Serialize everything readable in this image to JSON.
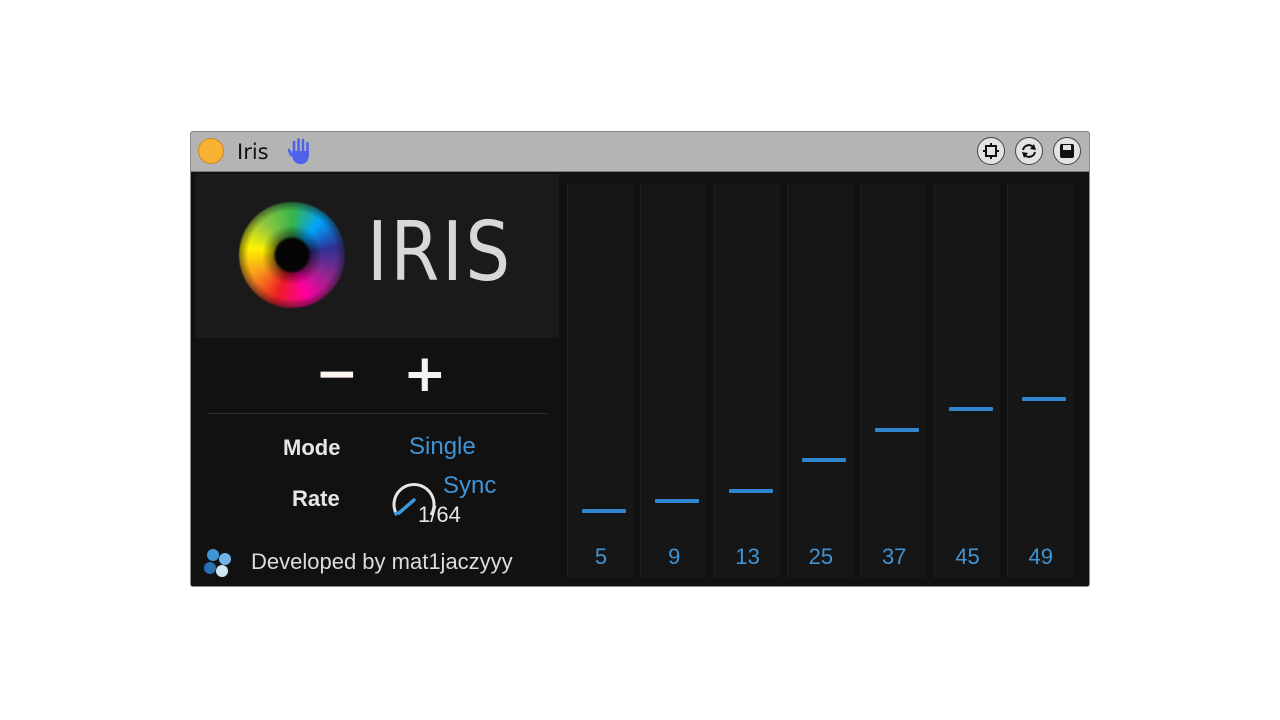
{
  "titlebar": {
    "title": "Iris"
  },
  "logo": {
    "wordmark": "IRIS"
  },
  "controls": {
    "minus_label": "−",
    "plus_label": "+",
    "mode_label": "Mode",
    "mode_value": "Single",
    "rate_label": "Rate",
    "rate_sync": "Sync",
    "rate_value": "1/64"
  },
  "footer": {
    "developer_text": "Developed by mat1jaczyyy"
  },
  "steps": [
    {
      "label": "5",
      "value": 5
    },
    {
      "label": "9",
      "value": 9
    },
    {
      "label": "13",
      "value": 13
    },
    {
      "label": "25",
      "value": 25
    },
    {
      "label": "37",
      "value": 37
    },
    {
      "label": "45",
      "value": 45
    },
    {
      "label": "49",
      "value": 49
    }
  ],
  "colors": {
    "accent": "#3f94d6",
    "power": "#f9b233",
    "hand": "#4d62e8"
  }
}
